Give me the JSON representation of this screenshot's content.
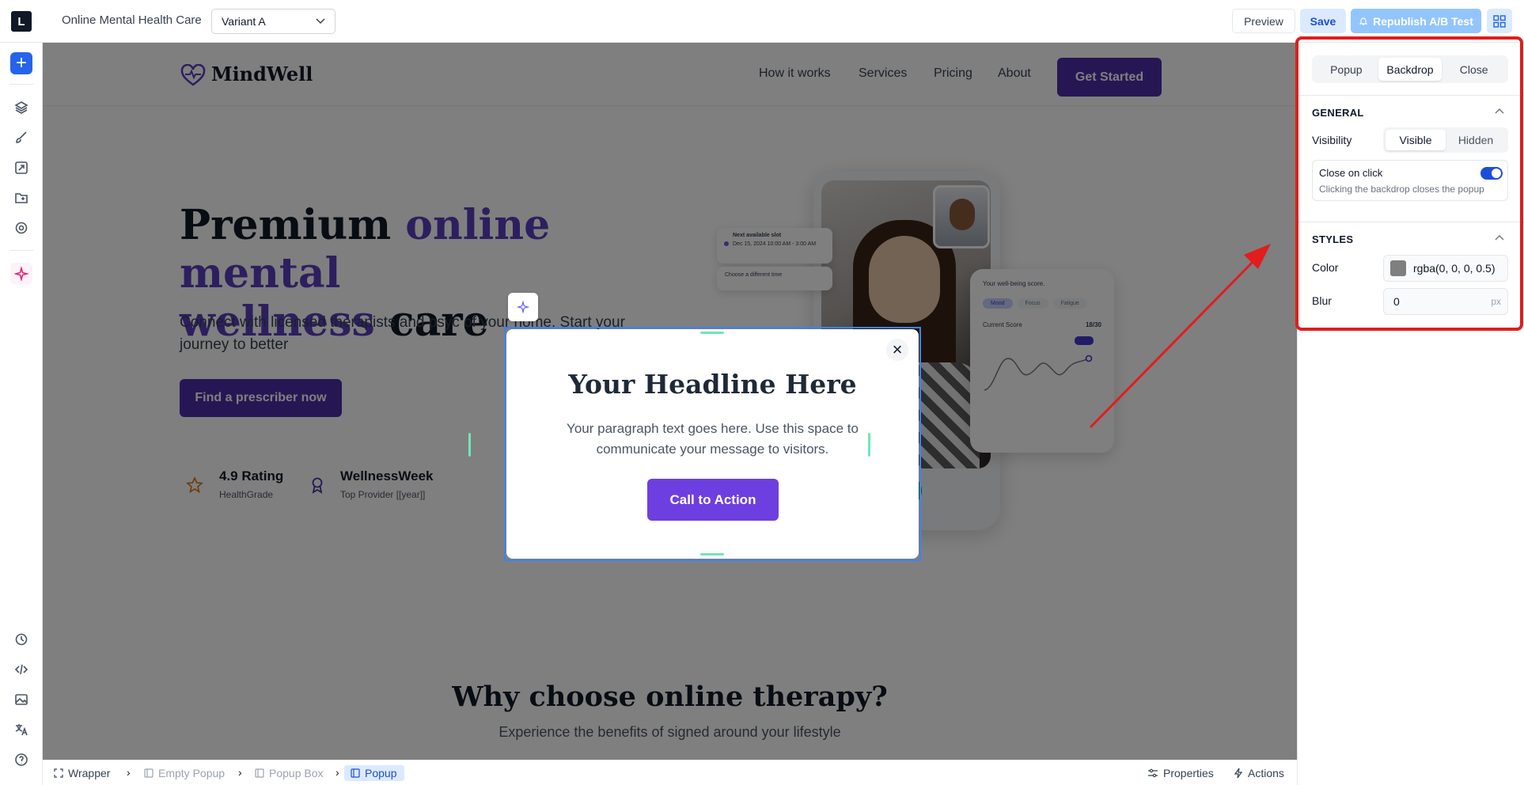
{
  "topbar": {
    "page_name": "Online Mental Health Care",
    "variant": "Variant A",
    "preview_label": "Preview",
    "save_label": "Save",
    "republish_label": "Republish A/B Test"
  },
  "site": {
    "brand": "MindWell",
    "nav": [
      "How it works",
      "Services",
      "Pricing",
      "About"
    ],
    "nav_cta": "Get Started",
    "hero_title_1": "Premium ",
    "hero_title_accent_1": "online mental",
    "hero_title_accent_2": "wellness",
    "hero_title_2": " care",
    "hero_sub": "Connect with licensed therapists and psyc of your home. Start your journey to better",
    "hero_btn": "Find a prescriber now",
    "stats": [
      {
        "title": "4.9 Rating",
        "sub": "HealthGrade"
      },
      {
        "title": "WellnessWeek",
        "sub": "Top Provider [[year]]"
      }
    ],
    "slot_title": "Next available slot",
    "slot_date": "Dec 15, 2024 10:00 AM - 3:00 AM",
    "slot2": "Choose a different time",
    "score_title": "Your well-being score.",
    "score_pills": [
      "Mood",
      "Focus",
      "Fatigue"
    ],
    "score_label": "Current Score",
    "score_value": "18/30",
    "why_title": "Why choose online therapy?",
    "why_sub": "Experience the benefits of                                                    signed around your lifestyle"
  },
  "popup": {
    "headline": "Your Headline Here",
    "text": "Your paragraph text goes here. Use this space to communicate your message to visitors.",
    "cta": "Call to Action",
    "close_glyph": "×"
  },
  "statusbar": {
    "breadcrumbs": [
      "Wrapper",
      "Empty Popup",
      "Popup Box",
      "Popup"
    ],
    "properties_label": "Properties",
    "actions_label": "Actions"
  },
  "panel": {
    "tabs": [
      "Popup",
      "Backdrop",
      "Close"
    ],
    "active_tab": "Backdrop",
    "general_title": "GENERAL",
    "visibility_label": "Visibility",
    "visibility_options": [
      "Visible",
      "Hidden"
    ],
    "close_on_click_label": "Close on click",
    "close_on_click_desc": "Clicking the backdrop closes the popup",
    "close_on_click": true,
    "styles_title": "STYLES",
    "color_label": "Color",
    "color_value": "rgba(0, 0, 0, 0.5)",
    "blur_label": "Blur",
    "blur_value": "0",
    "blur_unit": "px"
  },
  "colors": {
    "brand_purple": "#4c2fa8",
    "accent_purple": "#5b3fbf",
    "primary_blue": "#2563eb",
    "annotation_red": "#e11d1d"
  }
}
